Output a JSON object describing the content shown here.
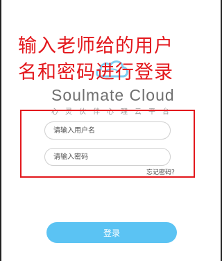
{
  "annotation": {
    "line1": "输入老师给的用户",
    "line2": "名和密码进行登录"
  },
  "brand": {
    "name": "Soulmate Cloud",
    "slogan": "心灵伙伴心理云平台"
  },
  "form": {
    "username_placeholder": "请输入用户名",
    "password_placeholder": "请输入密码",
    "forgot_label": "忘记密码？"
  },
  "login": {
    "label": "登录"
  },
  "colors": {
    "annotation": "#e3171c",
    "button": "#5bc3f3",
    "logo": "#7fcdf2"
  },
  "icons": {
    "logo": "cloud-logo-icon"
  }
}
